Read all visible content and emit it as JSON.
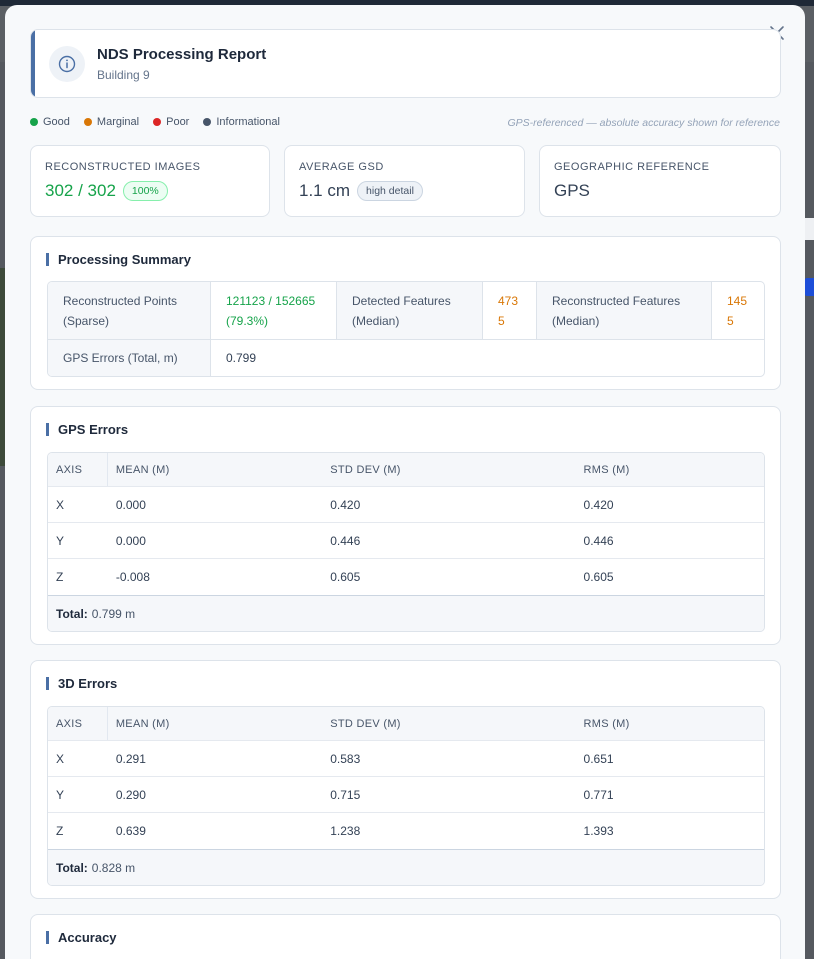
{
  "header": {
    "title": "NDS Processing Report",
    "subtitle": "Building 9"
  },
  "legend": {
    "items": [
      {
        "label": "Good",
        "color": "#16a34a"
      },
      {
        "label": "Marginal",
        "color": "#d97706"
      },
      {
        "label": "Poor",
        "color": "#dc2626"
      },
      {
        "label": "Informational",
        "color": "#475569"
      }
    ],
    "note": "GPS-referenced — absolute accuracy shown for reference"
  },
  "stats": {
    "images": {
      "label": "RECONSTRUCTED IMAGES",
      "value": "302 / 302",
      "badge": "100%"
    },
    "gsd": {
      "label": "AVERAGE GSD",
      "value": "1.1 cm",
      "badge": "high detail"
    },
    "georef": {
      "label": "GEOGRAPHIC REFERENCE",
      "value": "GPS"
    }
  },
  "summary": {
    "title": "Processing Summary",
    "points_label": "Reconstructed Points (Sparse)",
    "points_value": "121123 / 152665 (79.3%)",
    "detected_label": "Detected Features (Median)",
    "detected_value": "4735",
    "recon_label": "Reconstructed Features (Median)",
    "recon_value": "1455",
    "gps_label": "GPS Errors (Total, m)",
    "gps_value": "0.799"
  },
  "gps_errors": {
    "title": "GPS Errors",
    "headers": [
      "AXIS",
      "MEAN (M)",
      "STD DEV (M)",
      "RMS (M)"
    ],
    "rows": [
      [
        "X",
        "0.000",
        "0.420",
        "0.420"
      ],
      [
        "Y",
        "0.000",
        "0.446",
        "0.446"
      ],
      [
        "Z",
        "-0.008",
        "0.605",
        "0.605"
      ]
    ],
    "total_label": "Total:",
    "total_value": "0.799 m"
  },
  "errors_3d": {
    "title": "3D Errors",
    "headers": [
      "AXIS",
      "MEAN (M)",
      "STD DEV (M)",
      "RMS (M)"
    ],
    "rows": [
      [
        "X",
        "0.291",
        "0.583",
        "0.651"
      ],
      [
        "Y",
        "0.290",
        "0.715",
        "0.771"
      ],
      [
        "Z",
        "0.639",
        "1.238",
        "1.393"
      ]
    ],
    "total_label": "Total:",
    "total_value": "0.828 m"
  },
  "accuracy": {
    "title": "Accuracy"
  }
}
